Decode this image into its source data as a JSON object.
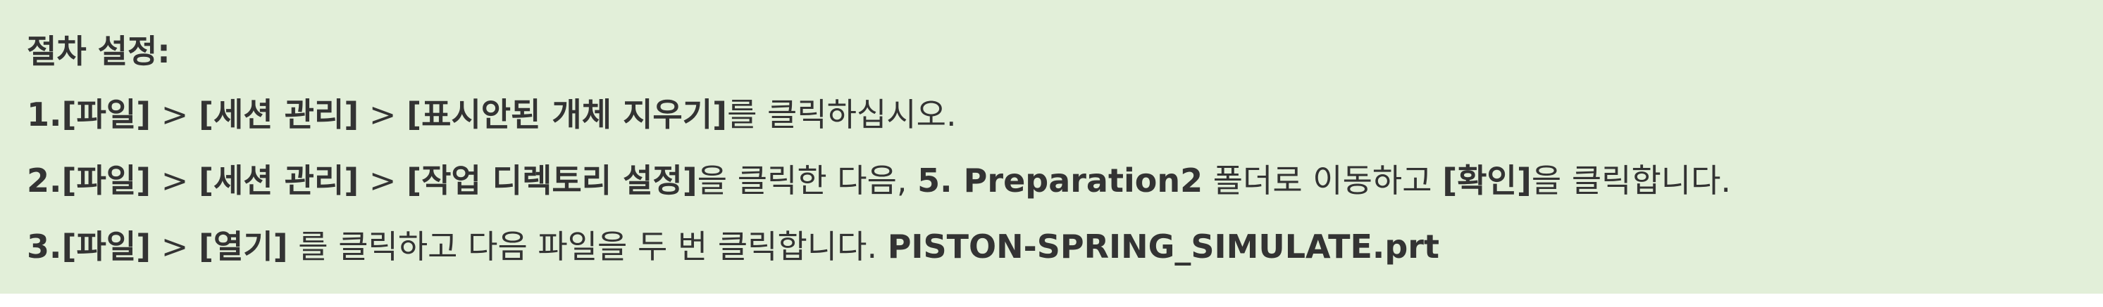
{
  "title": "절차 설정:",
  "steps": [
    {
      "parts": [
        {
          "text": "1.[파일]",
          "bold": true
        },
        {
          "text": " > ",
          "bold": false
        },
        {
          "text": "[세션 관리]",
          "bold": true
        },
        {
          "text": " > ",
          "bold": false
        },
        {
          "text": "[표시안된 개체 지우기]",
          "bold": true
        },
        {
          "text": "를 클릭하십시오.",
          "bold": false
        }
      ]
    },
    {
      "parts": [
        {
          "text": "2.[파일]",
          "bold": true
        },
        {
          "text": " > ",
          "bold": false
        },
        {
          "text": "[세션 관리]",
          "bold": true
        },
        {
          "text": " > ",
          "bold": false
        },
        {
          "text": "[작업 디렉토리 설정]",
          "bold": true
        },
        {
          "text": "을 클릭한 다음, ",
          "bold": false
        },
        {
          "text": "5. Preparation2",
          "bold": true
        },
        {
          "text": " 폴더로 이동하고 ",
          "bold": false
        },
        {
          "text": "[확인]",
          "bold": true
        },
        {
          "text": "을 클릭합니다.",
          "bold": false
        }
      ]
    },
    {
      "parts": [
        {
          "text": "3.[파일]",
          "bold": true
        },
        {
          "text": " > ",
          "bold": false
        },
        {
          "text": "[열기]",
          "bold": true
        },
        {
          "text": " 를 클릭하고 다음 파일을 두 번 클릭합니다. ",
          "bold": false
        },
        {
          "text": "PISTON-SPRING_SIMULATE.prt",
          "bold": true
        }
      ]
    }
  ]
}
